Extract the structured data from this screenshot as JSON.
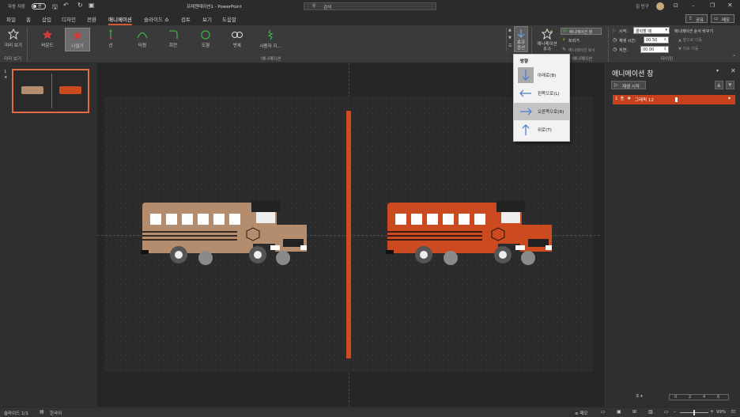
{
  "titlebar": {
    "autosave_label": "자동 저장",
    "autosave_state": "끔",
    "doc_title": "프레젠테이션1 - PowerPoint",
    "search_placeholder": "검색",
    "user_name": "김 민구"
  },
  "ribbon_tabs": [
    "파일",
    "홈",
    "삽입",
    "디자인",
    "전환",
    "애니메이션",
    "슬라이드 쇼",
    "검토",
    "보기",
    "도움말"
  ],
  "share_label": "공유",
  "comment_label": "메모",
  "ribbon": {
    "preview_label": "미리 보기",
    "preview_group": "미리 보기",
    "animations": [
      "바운드",
      "나밀기",
      "선",
      "타원",
      "회전",
      "도형",
      "반복",
      "사용자 지..."
    ],
    "animation_group": "애니메이션",
    "effect_options_label": "효과 옵션",
    "add_animation_label": "애니메이션 추가",
    "anim_pane_btn": "애니메이션 창",
    "trigger_btn": "트리거",
    "anim_painter_btn": "애니메이션 복사",
    "adv_group": "고급 애니메이션",
    "start_label": "시작:",
    "start_value": "클릭할 때",
    "duration_label": "재생 시간:",
    "duration_value": "00.50",
    "delay_label": "지연:",
    "delay_value": "00.00",
    "reorder_title": "애니메이션 순서 바꾸기",
    "move_earlier": "앞으로 이동",
    "move_later": "뒤로 이동",
    "timing_group": "타이밍"
  },
  "direction_menu": {
    "header": "방향",
    "items": [
      "아래로(B)",
      "왼쪽으로(L)",
      "오른쪽으로(R)",
      "위로(T)"
    ],
    "selected_index": 2
  },
  "thumbnail": {
    "number": "1",
    "star": "★"
  },
  "anim_pane": {
    "title": "애니메이션 창",
    "play_button": "재생 시작",
    "item_index": "1",
    "item_name": "그래픽 12"
  },
  "anim_pane_footer": {
    "seconds_label": "초",
    "timeline_ticks": [
      "0",
      "2",
      "4",
      "6"
    ]
  },
  "statusbar": {
    "slide_info": "슬라이드 1/1",
    "language": "한국어",
    "notes": "메모",
    "zoom": "99%"
  },
  "colors": {
    "accent": "#d65a31",
    "bus_tan": "#b38d6e",
    "bus_orange": "#cc4a1f",
    "divider": "#d24a1f"
  }
}
